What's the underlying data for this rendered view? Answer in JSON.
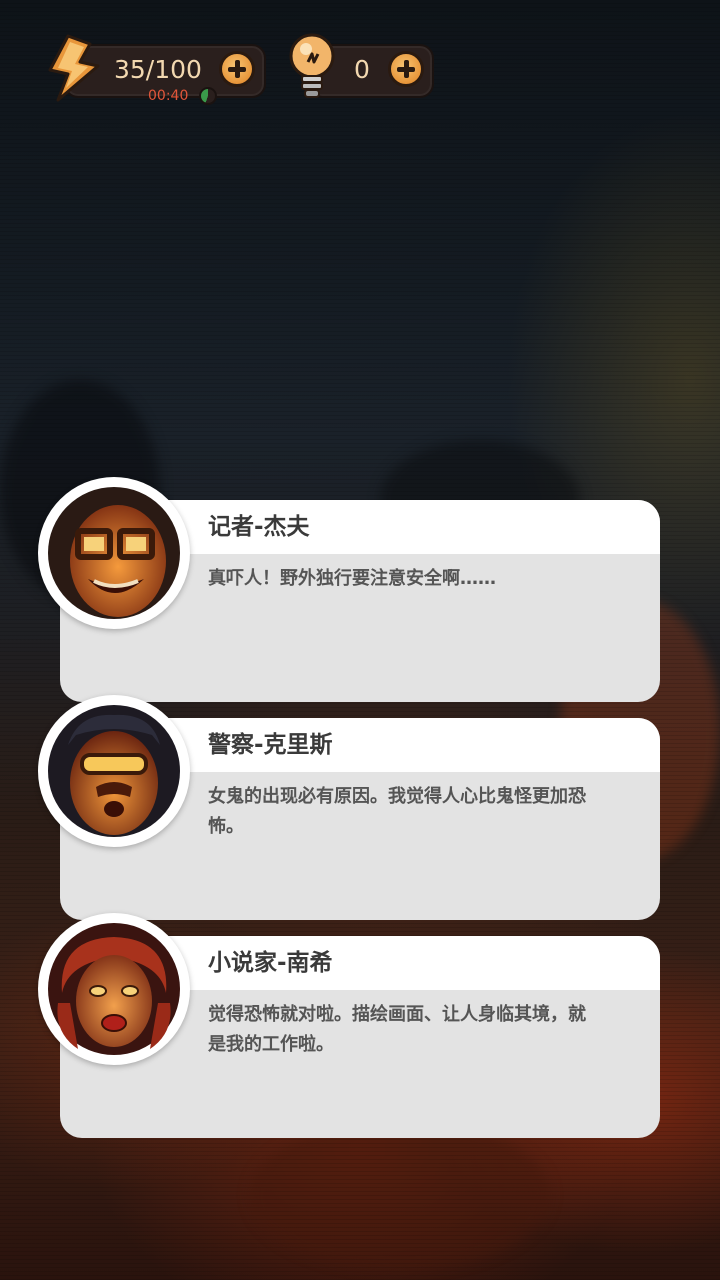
{
  "hud": {
    "energy": {
      "value": "35/100",
      "timer": "00:40",
      "icon": "lightning-bolt-icon",
      "add_icon": "plus-icon"
    },
    "hints": {
      "value": "0",
      "icon": "lightbulb-icon",
      "add_icon": "plus-icon"
    }
  },
  "dialogues": [
    {
      "name": "记者-杰夫",
      "text": "真吓人！野外独行要注意安全啊……",
      "avatar": "reporter-portrait"
    },
    {
      "name": "警察-克里斯",
      "text": "女鬼的出现必有原因。我觉得人心比鬼怪更加恐怖。",
      "avatar": "police-portrait"
    },
    {
      "name": "小说家-南希",
      "text": "觉得恐怖就对啦。描绘画面、让人身临其境，就是我的工作啦。",
      "avatar": "novelist-portrait"
    }
  ],
  "colors": {
    "accent": "#e8963a",
    "timer": "#e2563a",
    "card": "#e3e3e3",
    "card_header": "#ffffff"
  }
}
